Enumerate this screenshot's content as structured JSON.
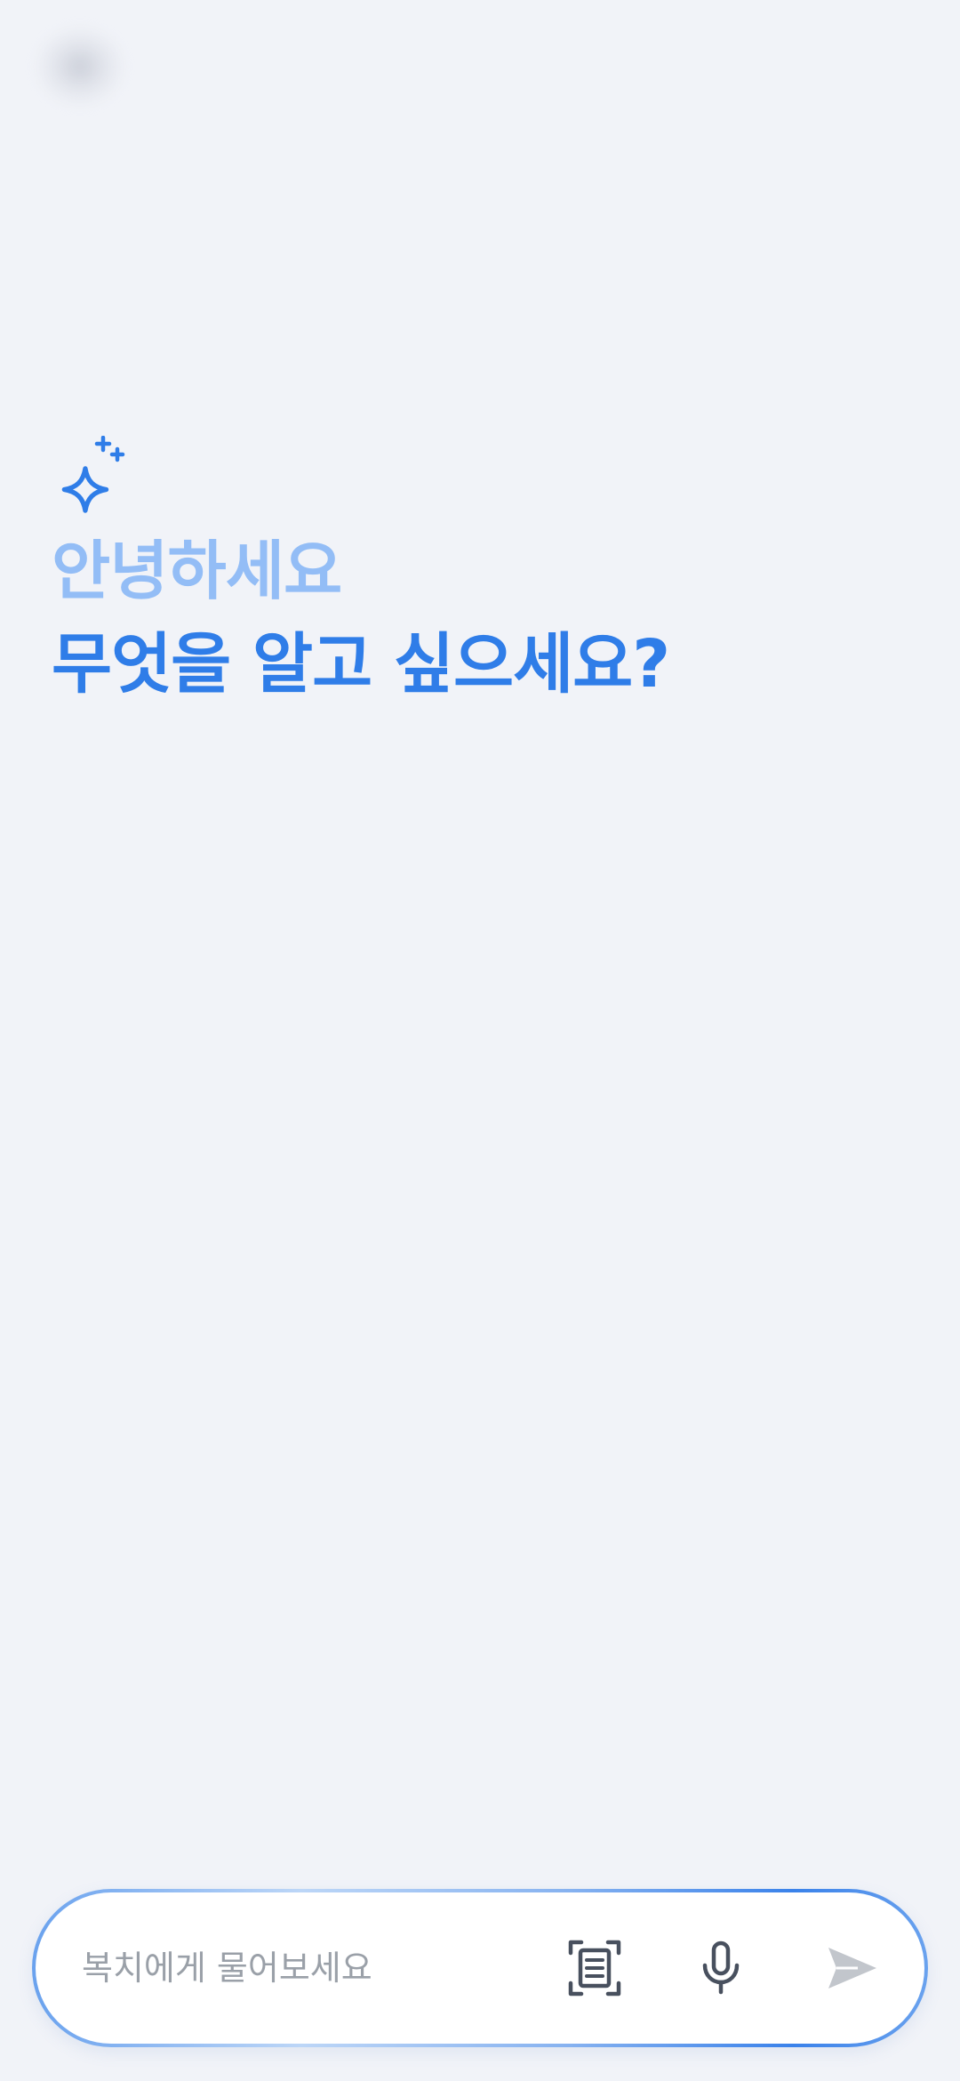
{
  "header": {
    "menu_icon": "menu-icon"
  },
  "hero": {
    "icon": "sparkle-icon",
    "greeting": "안녕하세요",
    "question": "무엇을 알고 싶으세요?",
    "greeting_color": "#93bdf6",
    "question_color": "#2f7de8"
  },
  "composer": {
    "placeholder": "복치에게 물어보세요",
    "value": "",
    "scan_icon": "document-scan-icon",
    "mic_icon": "microphone-icon",
    "send_icon": "send-icon"
  },
  "colors": {
    "background": "#f1f3f8",
    "accent": "#2f7de8"
  }
}
